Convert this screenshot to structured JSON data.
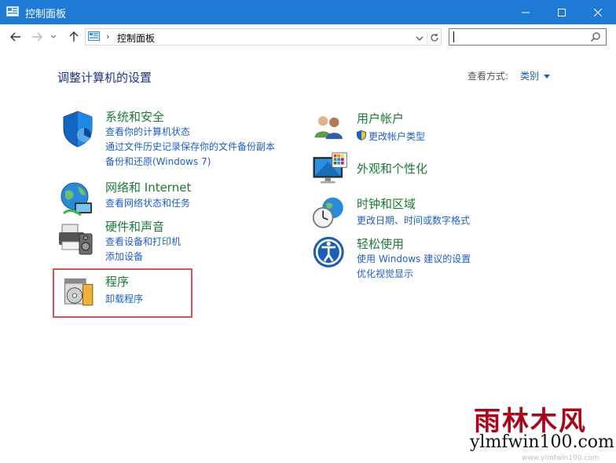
{
  "window": {
    "title": "控制面板",
    "controls": {
      "minimize": "minimize-icon",
      "maximize": "maximize-icon",
      "close": "close-icon"
    },
    "accent_color": "#1f7ad6"
  },
  "address": {
    "breadcrumb": "控制面板",
    "search_value": ""
  },
  "main": {
    "heading": "调整计算机的设置",
    "view_by_label": "查看方式:",
    "view_by_value": "类别"
  },
  "categories_left": [
    {
      "title": "系统和安全",
      "icon": "shield-icon",
      "links": [
        "查看你的计算机状态",
        "通过文件历史记录保存你的文件备份副本",
        "备份和还原(Windows 7)"
      ]
    },
    {
      "title": "网络和 Internet",
      "icon": "network-globe-icon",
      "links": [
        "查看网络状态和任务"
      ]
    },
    {
      "title": "硬件和声音",
      "icon": "printer-speaker-icon",
      "links": [
        "查看设备和打印机",
        "添加设备"
      ]
    },
    {
      "title": "程序",
      "icon": "programs-disc-icon",
      "links": [
        "卸载程序"
      ]
    }
  ],
  "categories_right": [
    {
      "title": "用户帐户",
      "icon": "users-icon",
      "links": [
        "更改帐户类型"
      ]
    },
    {
      "title": "外观和个性化",
      "icon": "monitor-palette-icon",
      "links": []
    },
    {
      "title": "时钟和区域",
      "icon": "clock-globe-icon",
      "links": [
        "更改日期、时间或数字格式"
      ]
    },
    {
      "title": "轻松使用",
      "icon": "ease-of-access-icon",
      "links": [
        "使用 Windows 建议的设置",
        "优化视觉显示"
      ]
    }
  ],
  "watermark": {
    "big": "雨林木风",
    "small": "ylmfwin100.com",
    "faint": "www.ylmfwin100.com",
    "color": "#a8061a"
  },
  "highlight_color": "#d9534f"
}
